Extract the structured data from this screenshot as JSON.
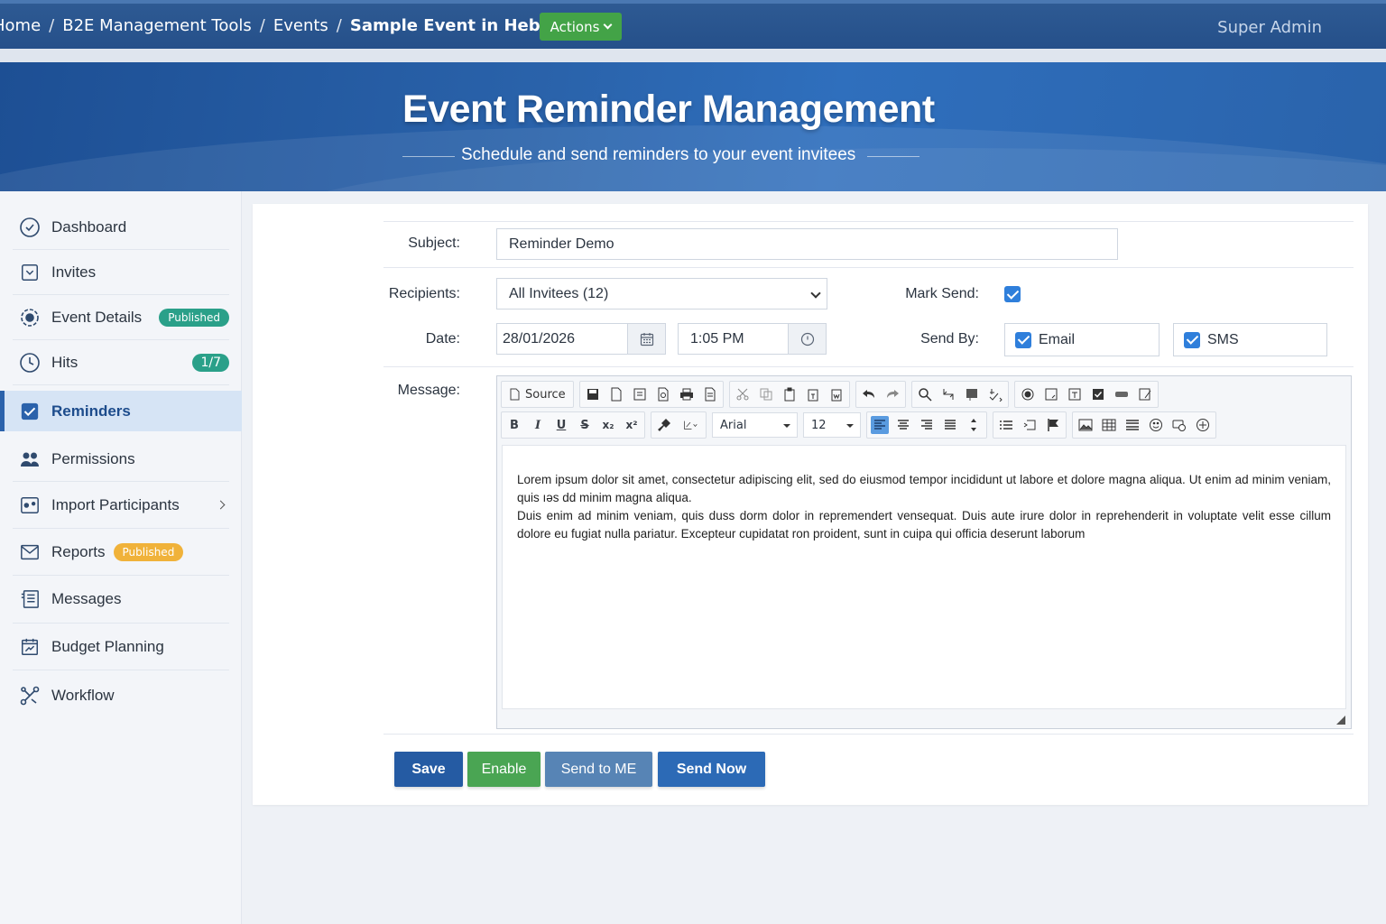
{
  "breadcrumb": {
    "home": "Home",
    "tools": "B2E Management Tools",
    "events": "Events",
    "current": "Sample Event in Hebrew",
    "separator": "/"
  },
  "header": {
    "actions_label": "Actions",
    "user_label": "Super Admin"
  },
  "hero": {
    "title": "Event Reminder Management",
    "subtitle": "Schedule and send reminders to your event invitees"
  },
  "sidebar": {
    "items": [
      {
        "label": "Dashboard",
        "icon": "dashboard-icon"
      },
      {
        "label": "Invites",
        "icon": "invites-icon"
      },
      {
        "label": "Event Details",
        "icon": "event-details-icon",
        "badge": "Published",
        "badge_color": "#2aa089"
      },
      {
        "label": "Hits",
        "icon": "clock-icon",
        "badge": "1/7",
        "badge_color": "#2aa089"
      },
      {
        "label": "Reminders",
        "icon": "checkbox-icon",
        "active": true
      },
      {
        "label": "Permissions",
        "icon": "users-icon"
      },
      {
        "label": "Import Participants",
        "icon": "import-icon",
        "has_submenu": true
      },
      {
        "label": "Reports",
        "icon": "envelope-icon",
        "badge": "Published",
        "badge_color": "#f0b23a"
      },
      {
        "label": "Messages",
        "icon": "messages-icon"
      },
      {
        "label": "Budget Planning",
        "icon": "budget-icon"
      },
      {
        "label": "Workflow",
        "icon": "workflow-icon"
      }
    ]
  },
  "form": {
    "subject_label": "Subject:",
    "subject_value": "Reminder Demo",
    "recipients_label": "Recipients:",
    "recipients_value": "All Invitees (12)",
    "mark_send_label": "Mark Send:",
    "mark_send_checked": true,
    "date_label": "Date:",
    "date_value": "28/01/2026",
    "time_value": "1:05 PM",
    "send_by_label": "Send By:",
    "send_by_email": "Email",
    "send_by_sms": "SMS",
    "email_checked": true,
    "sms_checked": true,
    "message_label": "Message:"
  },
  "editor": {
    "source_label": "Source",
    "font_name": "Arial",
    "font_size": "12",
    "content": [
      "Lorem ipsum dolor sit amet, consectetur adipiscing elit, sed do eiusmod tempor incididunt ut labore et dolore magna aliqua. Ut enim ad minim veniam, quis ıəs dd minim magna aliqua.",
      "Duis enim ad minim veniam, quis duss dorm dolor in repremendert vensequat. Duis aute irure dolor in reprehenderit in voluptate velit esse cillum dolore eu fugiat nulla pariatur. Excepteur cupidatat ron proident, sunt in cuipa qui officia deserunt laborum"
    ]
  },
  "buttons": {
    "save": "Save",
    "enable": "Enable",
    "send_to_me": "Send to ME",
    "send_now": "Send Now"
  },
  "colors": {
    "header": "#25508a",
    "accent": "#2b62ab",
    "green": "#43a347",
    "badge_green": "#2aa089",
    "badge_orange": "#f0b23a"
  }
}
